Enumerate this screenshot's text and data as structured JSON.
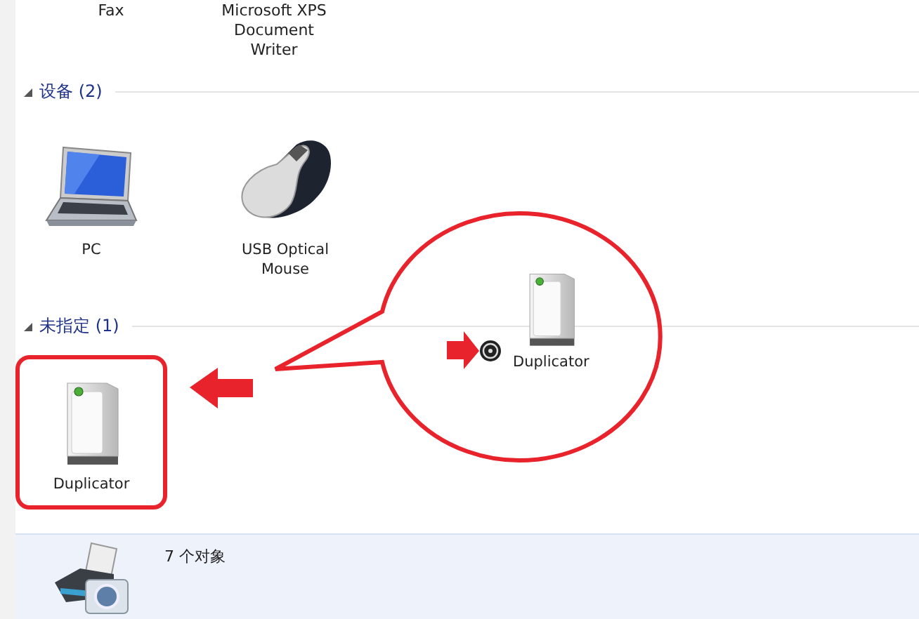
{
  "top_items": [
    {
      "label": "Fax"
    },
    {
      "label": "Microsoft XPS Document Writer"
    }
  ],
  "groups": [
    {
      "title": "设备 (2)",
      "expanded": true,
      "devices": [
        {
          "label": "PC",
          "kind": "laptop",
          "highlighted": false
        },
        {
          "label": "USB Optical Mouse",
          "kind": "mouse",
          "highlighted": false
        }
      ]
    },
    {
      "title": "未指定 (1)",
      "expanded": true,
      "devices": [
        {
          "label": "Duplicator",
          "kind": "tower",
          "highlighted": true
        }
      ]
    }
  ],
  "callout": {
    "label": "Duplicator"
  },
  "status_bar": {
    "text": "7 个对象"
  }
}
